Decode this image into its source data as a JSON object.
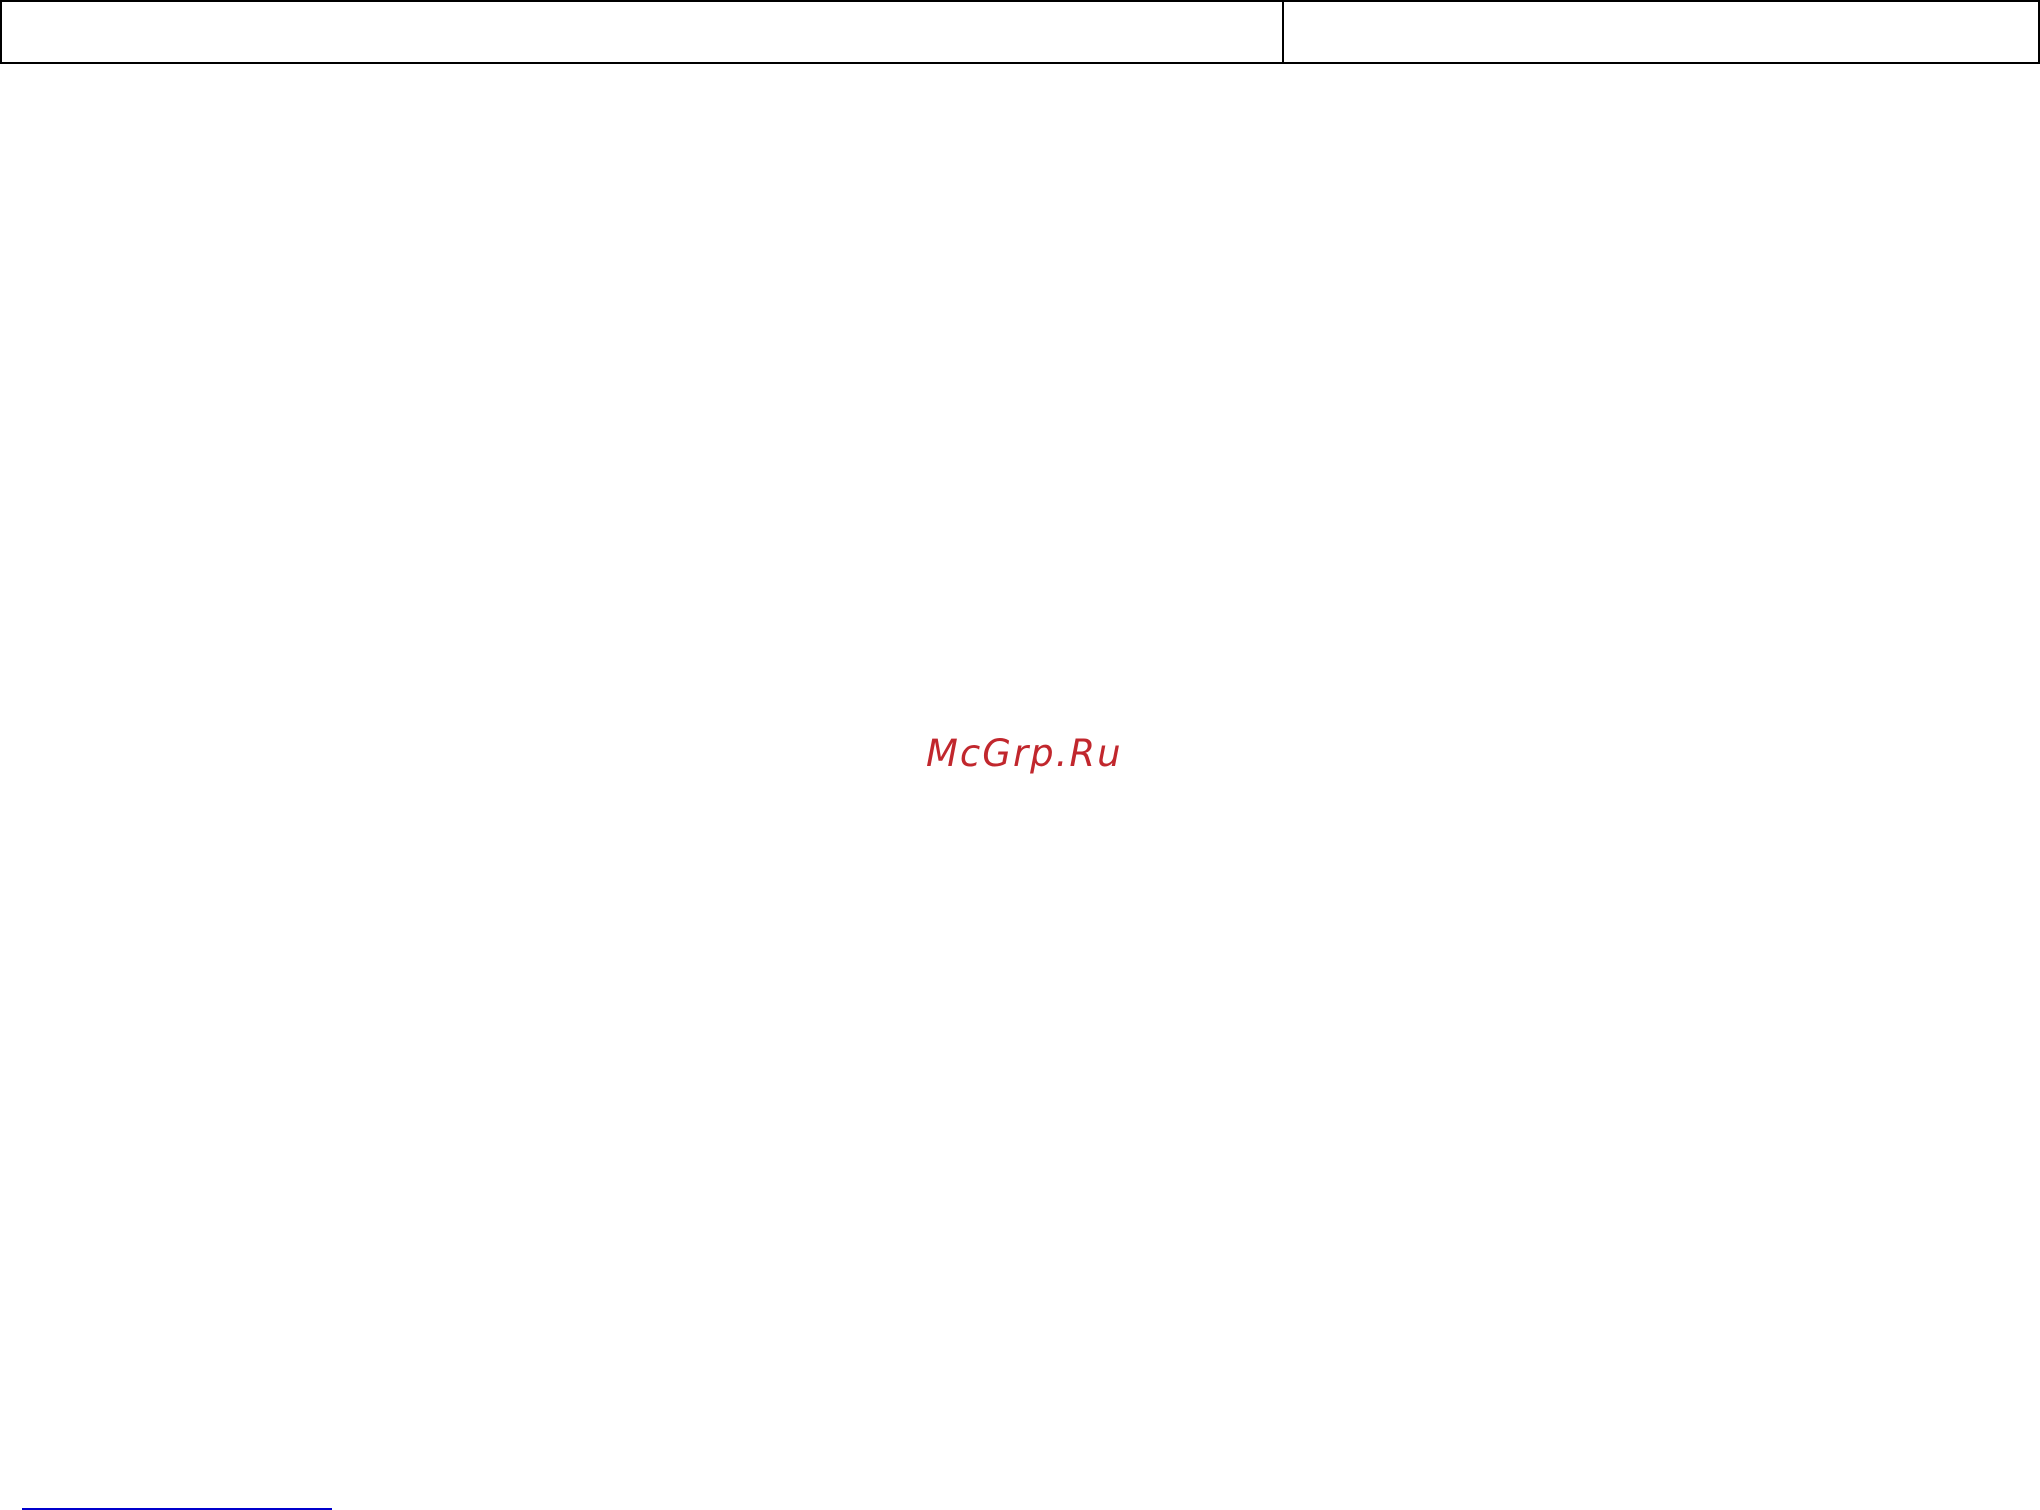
{
  "header": {
    "cells": [
      "",
      ""
    ]
  },
  "watermark": {
    "text": "McGrp.Ru",
    "color": "#c1272d"
  },
  "footnote": {
    "rule_color": "#0000cc"
  }
}
